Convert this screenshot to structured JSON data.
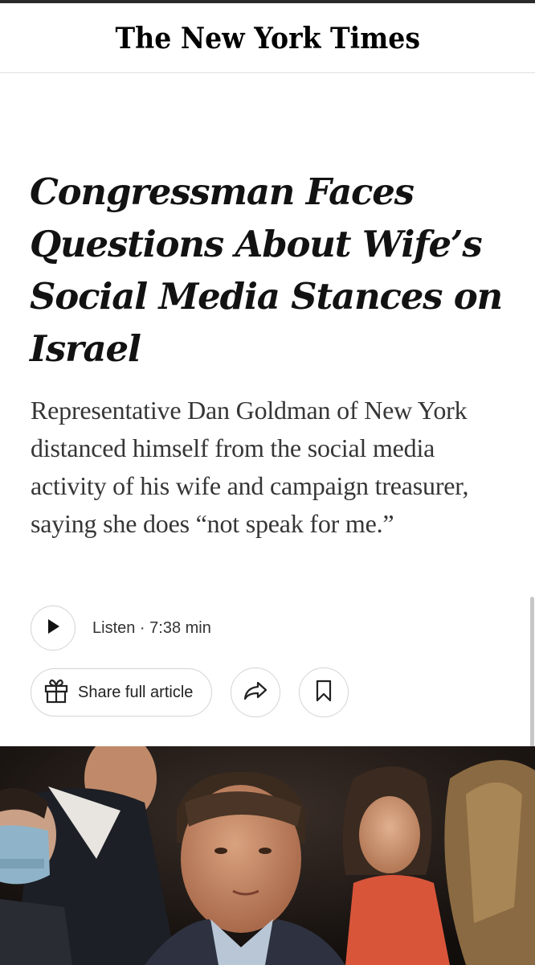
{
  "masthead": {
    "logo_text": "The New York Times"
  },
  "article": {
    "headline": "Congressman Faces Questions About Wife’s Social Media Stances on Israel",
    "summary": "Representative Dan Goldman of New York distanced himself from the social media activity of his wife and campaign treasurer, saying she does “not speak for me.”"
  },
  "audio": {
    "listen_label": "Listen · 7:38 min",
    "icon": "play-icon"
  },
  "actions": {
    "share_label": "Share full article",
    "gift_icon": "gift-icon",
    "share_icon": "share-arrow-icon",
    "save_icon": "bookmark-icon"
  },
  "colors": {
    "text": "#121212",
    "summary_text": "#363636",
    "border": "#d4d4d4",
    "background": "#ffffff"
  }
}
